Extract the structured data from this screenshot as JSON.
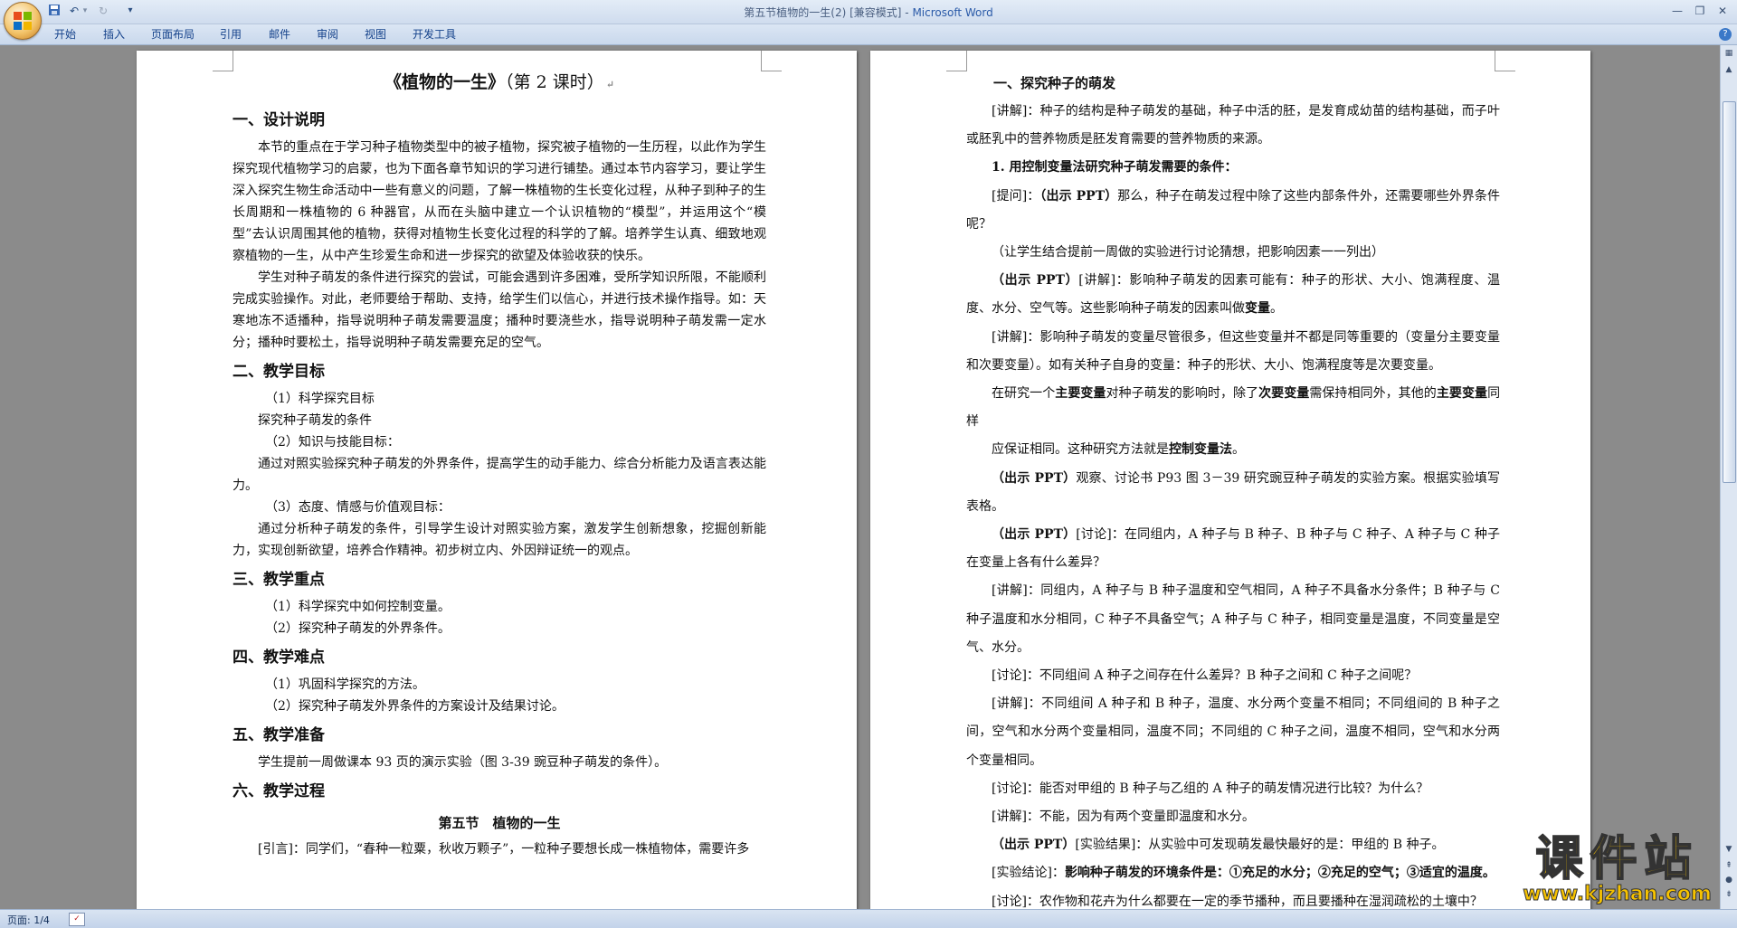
{
  "window": {
    "doc_name": "第五节植物的一生(2) [兼容模式]",
    "separator": " - ",
    "app_name": "Microsoft Word"
  },
  "ribbon": {
    "tabs": [
      "开始",
      "插入",
      "页面布局",
      "引用",
      "邮件",
      "审阅",
      "视图",
      "开发工具"
    ]
  },
  "page1": {
    "title_bold": "《植物的一生》",
    "title_rest": "（第 2 课时）",
    "h_design": "一、设计说明",
    "design_p1": "本节的重点在于学习种子植物类型中的被子植物，探究被子植物的一生历程，以此作为学生探究现代植物学习的启蒙，也为下面各章节知识的学习进行铺垫。通过本节内容学习，要让学生深入探究生物生命活动中一些有意义的问题，了解一株植物的生长变化过程，从种子到种子的生长周期和一株植物的 6 种器官，从而在头脑中建立一个认识植物的“模型”，并运用这个“模型”去认识周围其他的植物，获得对植物生长变化过程的科学的了解。培养学生认真、细致地观察植物的一生，从中产生珍爱生命和进一步探究的欲望及体验收获的快乐。",
    "design_p2": "学生对种子萌发的条件进行探究的尝试，可能会遇到许多困难，受所学知识所限，不能顺利完成实验操作。对此，老师要给于帮助、支持，给学生们以信心，并进行技术操作指导。如：天寒地冻不适播种，指导说明种子萌发需要温度；播种时要浇些水，指导说明种子萌发需一定水分；播种时要松土，指导说明种子萌发需要充足的空气。",
    "h_goals": "二、教学目标",
    "goal1_title": "（1）科学探究目标",
    "goal1_body": "探究种子萌发的条件",
    "goal2_title": "（2）知识与技能目标：",
    "goal2_body": "通过对照实验探究种子萌发的外界条件，提高学生的动手能力、综合分析能力及语言表达能力。",
    "goal3_title": "（3）态度、情感与价值观目标：",
    "goal3_body": "通过分析种子萌发的条件，引导学生设计对照实验方案，激发学生创新想象，挖掘创新能力，实现创新欲望，培养合作精神。初步树立内、外因辩证统一的观点。",
    "h_key": "三、教学重点",
    "key1": "（1）科学探究中如何控制变量。",
    "key2": "（2）探究种子萌发的外界条件。",
    "h_diff": "四、教学难点",
    "diff1": "（1）巩固科学探究的方法。",
    "diff2": "（2）探究种子萌发外界条件的方案设计及结果讨论。",
    "h_prep": "五、教学准备",
    "prep_body": "学生提前一周做课本 93 页的演示实验（图 3-39 豌豆种子萌发的条件）。",
    "h_process": "六、教学过程",
    "section_title": "第五节　植物的一生",
    "intro": "[引言]：同学们，“春种一粒粟，秋收万颗子”，一粒种子要想长成一株植物体，需要许多"
  },
  "page2": {
    "heading": "一、探究种子的萌发",
    "l1": "[讲解]：种子的结构是种子萌发的基础，种子中活的胚，是发育成幼苗的结构基础，而子叶或胚乳中的营养物质是胚发育需要的营养物质的来源。",
    "l2": "1. 用控制变量法研究种子萌发需要的条件：",
    "l3_pre": "[提问]：",
    "l3_bold": "（出示 PPT）",
    "l3_rest": "那么，种子在萌发过程中除了这些内部条件外，还需要哪些外界条件呢？",
    "l4": "（让学生结合提前一周做的实验进行讨论猜想，把影响因素一一列出）",
    "l5_bold": "（出示 PPT）",
    "l5_rest": "[讲解]：影响种子萌发的因素可能有：种子的形状、大小、饱满程度、温度、水分、空气等。这些影响种子萌发的因素叫做",
    "l5_bold2": "变量",
    "l5_end": "。",
    "l6": "[讲解]：影响种子萌发的变量尽管很多，但这些变量并不都是同等重要的（变量分主要变量和次要变量）。如有关种子自身的变量：种子的形状、大小、饱满程度等是次要变量。",
    "l7_a": "在研究一个",
    "l7_b": "主要变量",
    "l7_c": "对种子萌发的影响时，除了",
    "l7_d": "次要变量",
    "l7_e": "需保持相同外，其他的",
    "l7_f": "主要变量",
    "l7_g": "同样",
    "l8_a": "应保证相同。这种研究方法就是",
    "l8_b": "控制变量法",
    "l8_c": "。",
    "l9_bold": "（出示 PPT）",
    "l9_rest": "观察、讨论书 P93 图 3－39 研究豌豆种子萌发的实验方案。根据实验填写表格。",
    "l10_bold": "（出示 PPT）",
    "l10_rest": "[讨论]：在同组内，A 种子与 B 种子、B 种子与 C 种子、A 种子与 C 种子在变量上各有什么差异？",
    "l11": "[讲解]：同组内，A 种子与 B 种子温度和空气相同，A 种子不具备水分条件；B 种子与 C 种子温度和水分相同，C 种子不具备空气；A 种子与 C 种子，相同变量是温度，不同变量是空气、水分。",
    "l12": "[讨论]：不同组间 A 种子之间存在什么差异？B 种子之间和 C 种子之间呢？",
    "l13": "[讲解]：不同组间 A 种子和 B 种子，温度、水分两个变量不相同；不同组间的 B 种子之间，空气和水分两个变量相同，温度不同；不同组的 C 种子之间，温度不相同，空气和水分两个变量相同。",
    "l14": "[讨论]：能否对甲组的 B 种子与乙组的 A 种子的萌发情况进行比较？为什么？",
    "l15": "[讲解]：不能，因为有两个变量即温度和水分。",
    "l16_bold": "（出示 PPT）",
    "l16_rest": "[实验结果]：从实验中可发现萌发最快最好的是：甲组的 B 种子。",
    "l17_pre": "[实验结论]：",
    "l17_bold": "影响种子萌发的环境条件是：①充足的水分；②充足的空气；③适宜的温度。",
    "l18": "[讨论]：农作物和花卉为什么都要在一定的季节播种，而且要播种在湿润疏松的土壤中？"
  },
  "status": {
    "page": "页面: 1/4"
  },
  "watermark": {
    "text": "课件站",
    "url": "www.kjzhan.com"
  }
}
